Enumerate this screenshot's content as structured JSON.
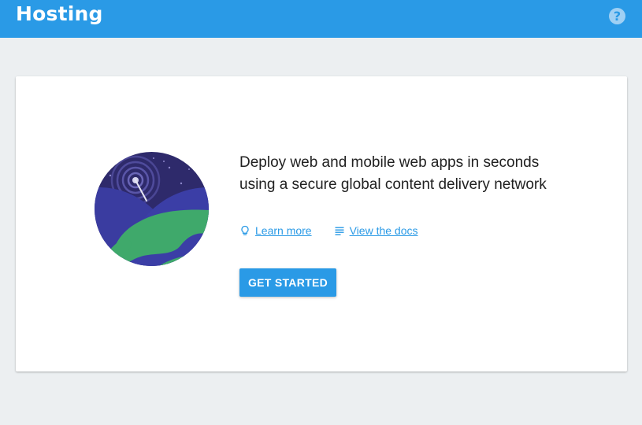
{
  "header": {
    "title": "Hosting",
    "help_icon": "help-circle-icon",
    "help_glyph": "?"
  },
  "card": {
    "illustration": "globe-satellite-icon",
    "description": "Deploy web and mobile web apps in seconds using a secure global content delivery network",
    "links": [
      {
        "icon": "lightbulb-icon",
        "label": "Learn more"
      },
      {
        "icon": "docs-icon",
        "label": "View the docs"
      }
    ],
    "cta_label": "GET STARTED"
  },
  "colors": {
    "header_bg": "#2a9ae6",
    "page_bg": "#eceff1",
    "accent": "#2a9ae6",
    "text": "#212121"
  }
}
